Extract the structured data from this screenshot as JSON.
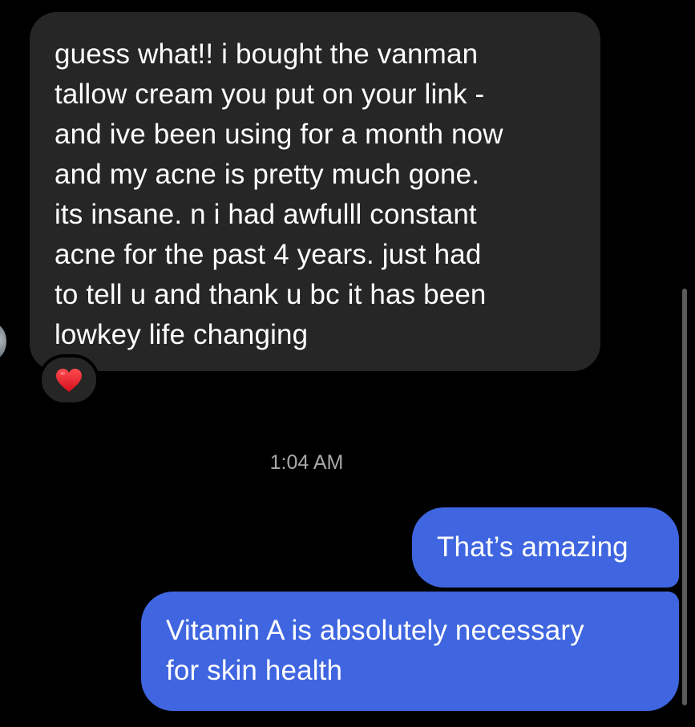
{
  "conversation": {
    "incoming_message": {
      "lines": [
        "guess what!! i bought the vanman",
        "tallow cream you put on your link -",
        "and ive been using for a month now",
        "and my acne is pretty much gone.",
        "its insane. n i had awfulll constant",
        "acne for the past 4 years. just had",
        "to tell u and thank u bc it has been",
        "lowkey life changing"
      ],
      "reaction": "heart-icon"
    },
    "timestamp": "1:04 AM",
    "outgoing_messages": [
      {
        "lines": [
          "That’s amazing"
        ]
      },
      {
        "lines": [
          "Vitamin A is absolutely necessary",
          "for skin health"
        ]
      }
    ]
  },
  "colors": {
    "background": "#000000",
    "incoming_bubble": "#262626",
    "outgoing_bubble": "#3f66e0",
    "timestamp_text": "#a8a8a8",
    "reaction_heart": "#e8202c"
  }
}
